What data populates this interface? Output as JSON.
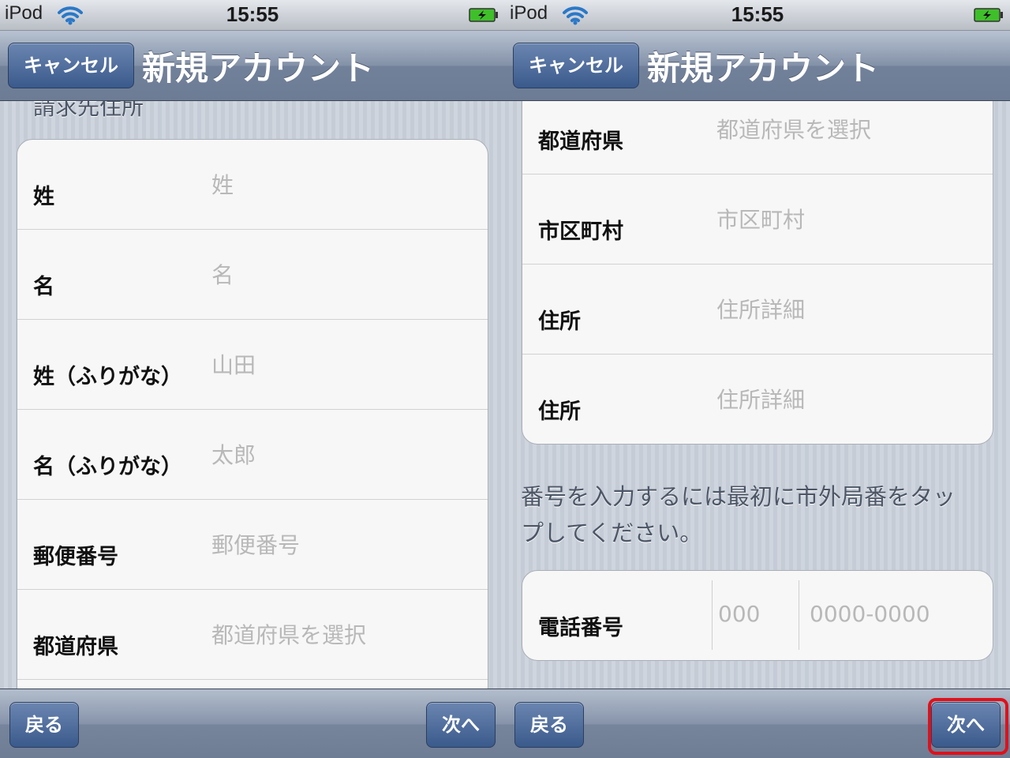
{
  "status": {
    "carrier": "iPod",
    "time": "15:55"
  },
  "nav": {
    "cancel_label": "キャンセル",
    "title": "新規アカウント"
  },
  "left": {
    "section_label": "請求先住所",
    "rows": [
      {
        "label": "姓",
        "placeholder": "姓"
      },
      {
        "label": "名",
        "placeholder": "名"
      },
      {
        "label": "姓（ふりがな）",
        "placeholder": "山田"
      },
      {
        "label": "名（ふりがな）",
        "placeholder": "太郎"
      },
      {
        "label": "郵便番号",
        "placeholder": "郵便番号"
      },
      {
        "label": "都道府県",
        "placeholder": "都道府県を選択"
      }
    ]
  },
  "right": {
    "rows": [
      {
        "label": "都道府県",
        "placeholder": "都道府県を選択"
      },
      {
        "label": "市区町村",
        "placeholder": "市区町村"
      },
      {
        "label": "住所",
        "placeholder": "住所詳細"
      },
      {
        "label": "住所",
        "placeholder": "住所詳細"
      }
    ],
    "note": "番号を入力するには最初に市外局番をタップしてください。",
    "phone": {
      "label": "電話番号",
      "area_placeholder": "000",
      "number_placeholder": "0000-0000"
    }
  },
  "toolbar": {
    "back_label": "戻る",
    "next_label": "次へ"
  },
  "colors": {
    "highlight": "#e0101a",
    "button": "#3a5a8c"
  }
}
